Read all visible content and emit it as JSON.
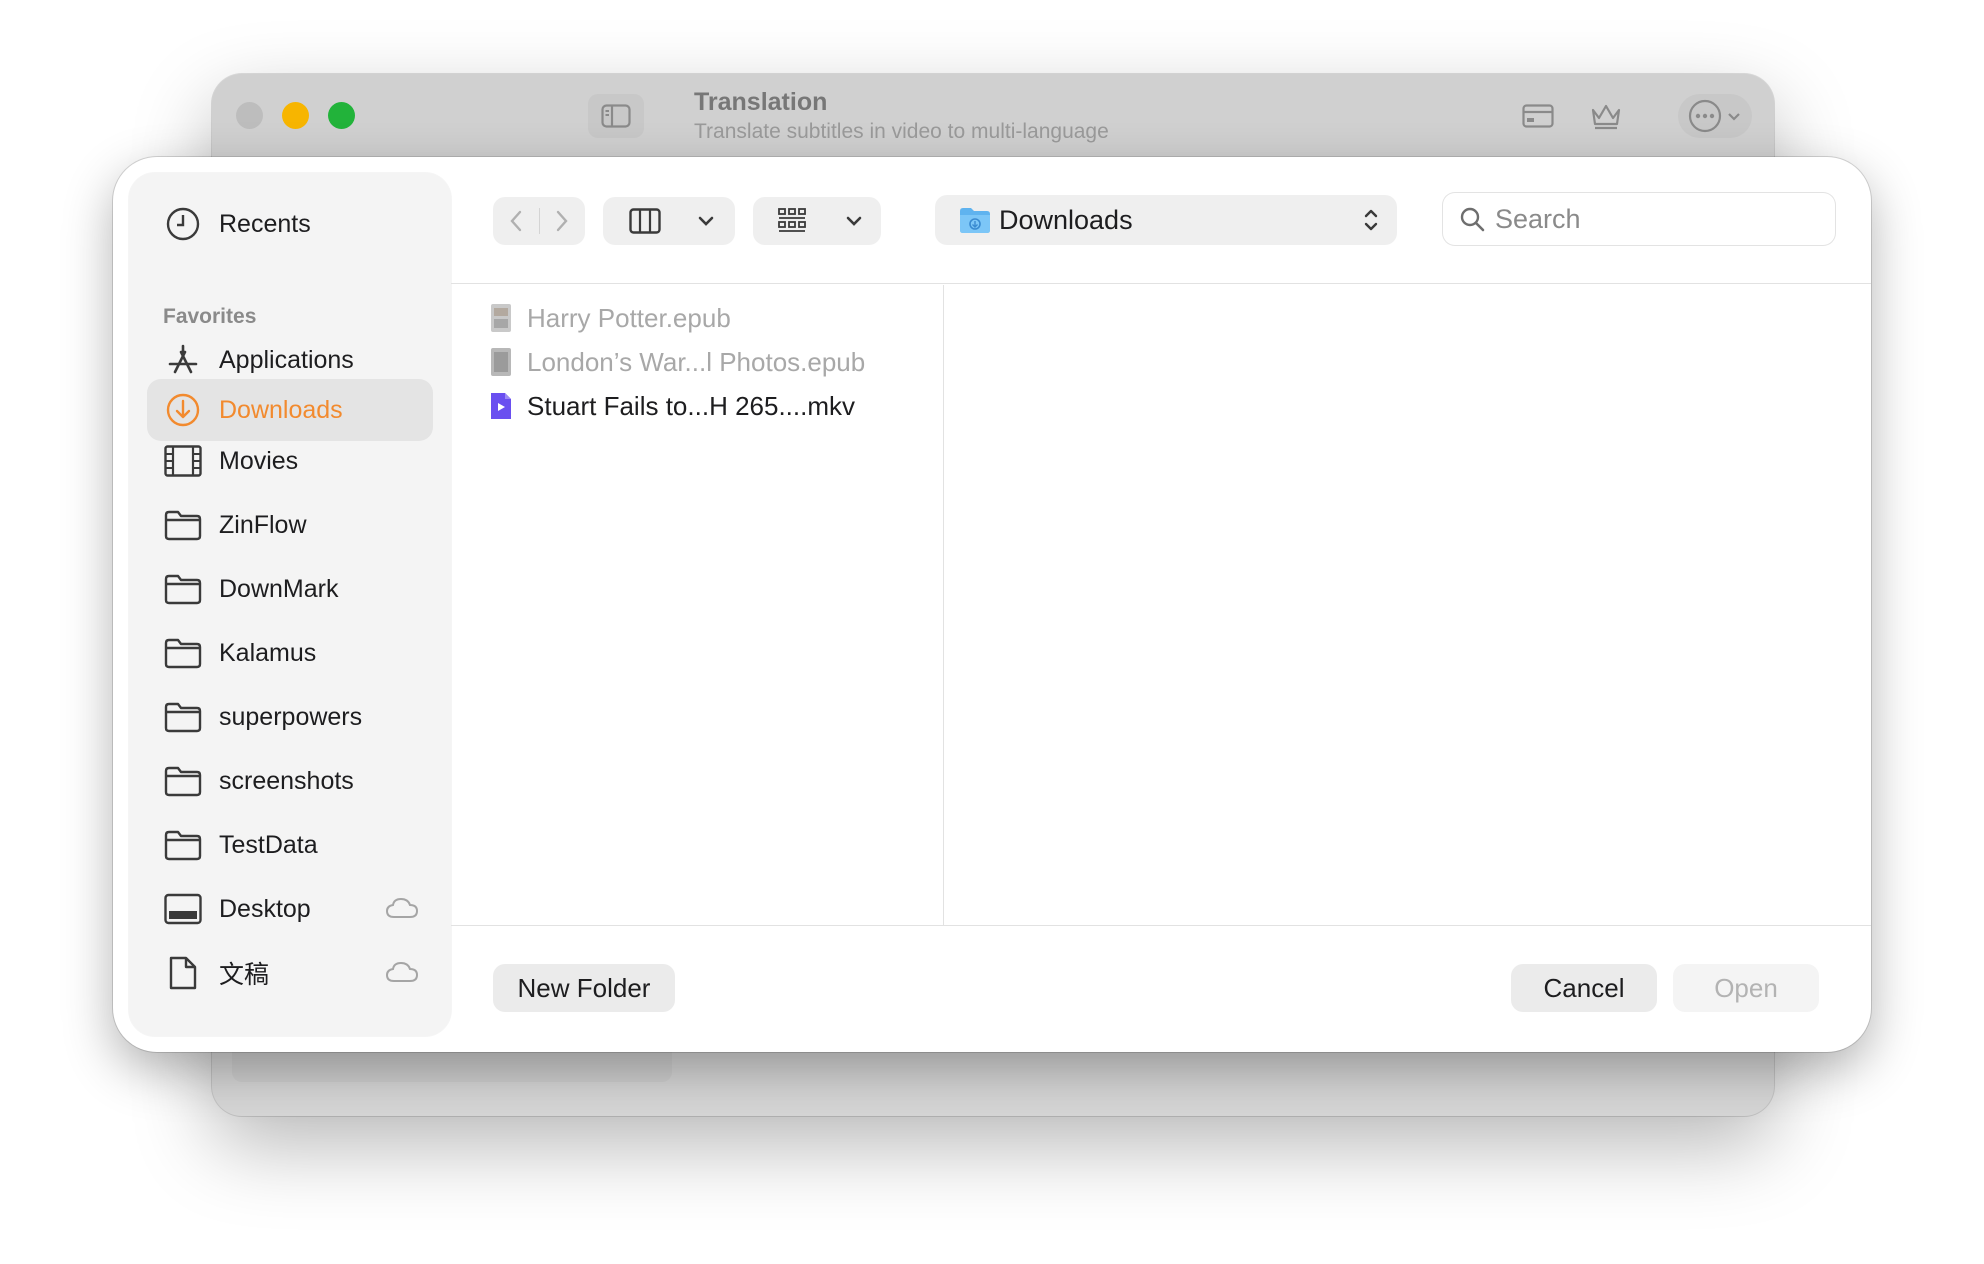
{
  "background_window": {
    "title": "Translation",
    "subtitle": "Translate subtitles in video to multi-language",
    "icons": [
      "sidebar-toggle-icon",
      "card-icon",
      "crown-icon",
      "ellipsis-circle-icon",
      "chevron-down-icon"
    ]
  },
  "sidebar": {
    "recents_label": "Recents",
    "favorites_heading": "Favorites",
    "items": [
      {
        "label": "Applications",
        "icon": "applications-icon"
      },
      {
        "label": "Downloads",
        "icon": "downloads-icon",
        "selected": true
      },
      {
        "label": "Movies",
        "icon": "film-icon"
      },
      {
        "label": "ZinFlow",
        "icon": "folder-icon"
      },
      {
        "label": "DownMark",
        "icon": "folder-icon"
      },
      {
        "label": "Kalamus",
        "icon": "folder-icon"
      },
      {
        "label": "superpowers",
        "icon": "folder-icon"
      },
      {
        "label": "screenshots",
        "icon": "folder-icon"
      },
      {
        "label": "TestData",
        "icon": "folder-icon"
      },
      {
        "label": "Desktop",
        "icon": "desktop-icon",
        "cloud": true
      },
      {
        "label": "文稿",
        "icon": "document-icon",
        "cloud": true
      }
    ]
  },
  "toolbar": {
    "location": "Downloads",
    "search_placeholder": "Search"
  },
  "files": [
    {
      "name": "Harry Potter.epub",
      "enabled": false
    },
    {
      "name": "London’s War...l Photos.epub",
      "enabled": false
    },
    {
      "name": "Stuart Fails to...H 265....mkv",
      "enabled": true
    }
  ],
  "footer": {
    "new_folder": "New Folder",
    "cancel": "Cancel",
    "open": "Open"
  },
  "colors": {
    "accent": "#f28a2e",
    "video_file": "#6a4ff0",
    "traffic_min": "#f7b500",
    "traffic_max": "#22b33a"
  }
}
